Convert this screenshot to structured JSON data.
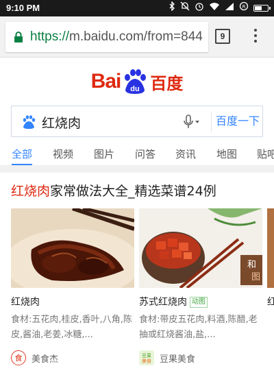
{
  "status_bar": {
    "time": "9:10 PM",
    "battery_level": 0.6,
    "icons": [
      "bluetooth-icon",
      "mute-icon",
      "alarm-icon",
      "wifi-icon",
      "signal-icon",
      "data-saver-icon",
      "battery-icon"
    ]
  },
  "browser": {
    "url_scheme": "https://",
    "url_rest": "m.baidu.com/from=844",
    "tab_count": "9"
  },
  "logo": {
    "text_left": "Bai",
    "paw_text": "du",
    "text_cn": "百度"
  },
  "search": {
    "query": "红烧肉",
    "button_label": "百度一下"
  },
  "tabs": [
    "全部",
    "视频",
    "图片",
    "问答",
    "资讯",
    "地图",
    "贴吧"
  ],
  "result": {
    "title_highlight": "红烧肉",
    "title_rest": "家常做法大全_精选菜谱24例",
    "cards": [
      {
        "name": "红烧肉",
        "tag": "",
        "description": "食材:五花肉,桂皮,香叶,八角,陈皮,酱油,老姜,冰糖,...",
        "author": "美食杰"
      },
      {
        "name": "苏式红烧肉",
        "tag": "动图",
        "description": "食材:带皮五花肉,料酒,陈醋,老抽或红烧酱油,盐,...",
        "author": "豆果美食"
      }
    ],
    "partial_card": {
      "name": "红",
      "overlay_text": "和\n图"
    }
  },
  "colors": {
    "baidu_red": "#de2910",
    "baidu_blue": "#3385ff",
    "url_green": "#0b8043"
  }
}
